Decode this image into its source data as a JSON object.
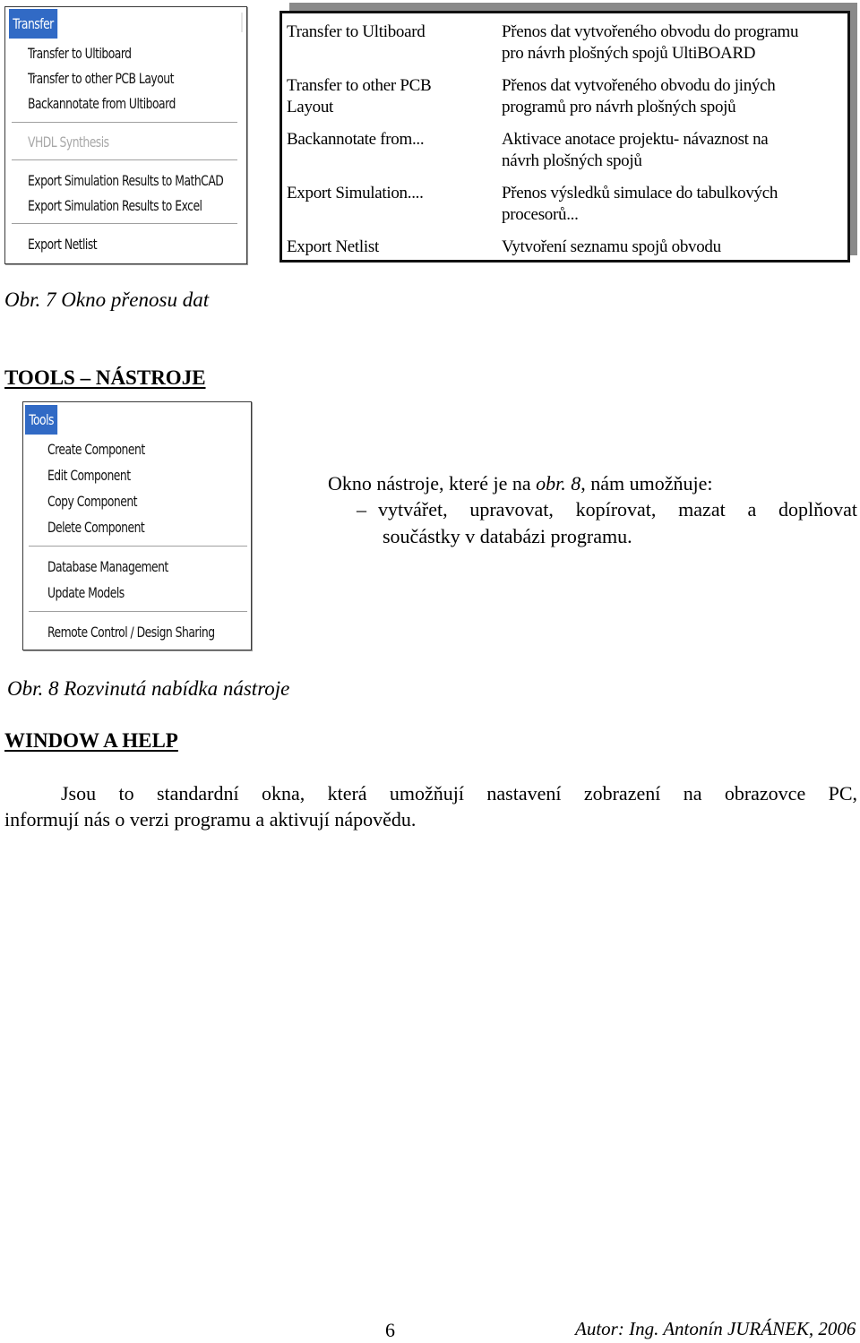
{
  "transfer_menu": {
    "title": "Transfer",
    "groups": [
      [
        "Transfer to Ultiboard",
        "Transfer to other PCB Layout",
        "Backannotate from Ultiboard"
      ],
      [
        "VHDL Synthesis"
      ],
      [
        "Export Simulation Results to MathCAD",
        "Export Simulation Results to Excel"
      ],
      [
        "Export Netlist"
      ]
    ],
    "disabled_items": [
      "VHDL Synthesis"
    ]
  },
  "transfer_table": {
    "rows": [
      {
        "command": [
          "Transfer to Ultiboard"
        ],
        "description": [
          "Přenos dat vytvořeného obvodu do programu",
          "pro návrh plošných spojů UltiBOARD"
        ]
      },
      {
        "command": [
          "Transfer to other PCB",
          "Layout"
        ],
        "description": [
          "Přenos dat vytvořeného obvodu do jiných",
          "programů pro návrh plošných spojů"
        ]
      },
      {
        "command": [
          "Backannotate from..."
        ],
        "description": [
          "Aktivace anotace projektu- návaznost na",
          "návrh plošných spojů"
        ]
      },
      {
        "command": [
          "Export Simulation...."
        ],
        "description": [
          "Přenos výsledků simulace do tabulkových",
          "procesorů..."
        ]
      },
      {
        "command": [
          "Export Netlist"
        ],
        "description": [
          "Vytvoření seznamu spojů obvodu"
        ]
      }
    ]
  },
  "figure7_caption": "Obr. 7 Okno přenosu dat",
  "tools_section": {
    "heading": "TOOLS – NÁSTROJE",
    "menu": {
      "title": "Tools",
      "groups": [
        [
          "Create Component",
          "Edit Component",
          "Copy Component",
          "Delete Component"
        ],
        [
          "Database Management",
          "Update Models"
        ],
        [
          "Remote Control / Design Sharing"
        ]
      ]
    },
    "description": {
      "intro_before": "Okno nástroje, které je na ",
      "intro_ref": "obr. 8",
      "intro_after": ", nám umožňuje:",
      "bullet_dash": "–",
      "bullet_line1": "vytvářet, upravovat, kopírovat, mazat a doplňovat",
      "bullet_line2": "součástky v databázi programu."
    },
    "figure8_caption": "Obr. 8 Rozvinutá nabídka nástroje"
  },
  "window_help_section": {
    "heading": "WINDOW A HELP",
    "paragraph_line1": "Jsou to standardní okna, která umožňují nastavení zobrazení na obrazovce PC,",
    "paragraph_line2": "informují nás o verzi programu a aktivují nápovědu."
  },
  "footer": {
    "page_number": "6",
    "author": "Autor: Ing. Antonín JURÁNEK, 2006"
  },
  "colors": {
    "menu_highlight": "#316ac5",
    "table_shadow": "#8a8a8a"
  }
}
